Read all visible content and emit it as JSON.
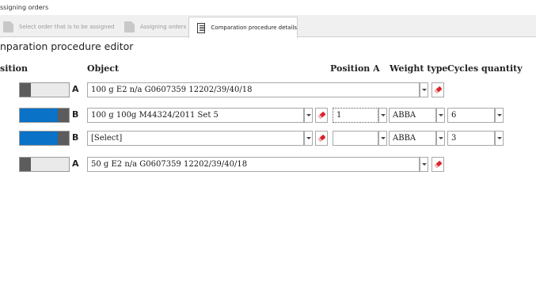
{
  "window": {
    "title": "ssigning orders"
  },
  "tabs": [
    {
      "label": "Select order that is to be assigned",
      "icon": "document-icon",
      "active": false
    },
    {
      "label": "Assigning orders",
      "icon": "document-icon",
      "active": false
    },
    {
      "label": "Comparation procedure details",
      "icon": "form-icon",
      "active": true
    }
  ],
  "editor": {
    "title": "nparation procedure editor",
    "columns": {
      "position": "sition",
      "object": "Object",
      "position_a": "Position A",
      "weight_type": "Weight type",
      "cycles_quantity": "Cycles quantity"
    },
    "rows": [
      {
        "toggle_level": 0,
        "letter": "A",
        "object": "100 g E2 n/a G0607359 12202/39/40/18"
      },
      {
        "toggle_level": 1,
        "letter": "B",
        "object": "100 g 100g M44324/2011 Set 5",
        "position_a": "1",
        "weight_type": "ABBA",
        "cycles": "6"
      },
      {
        "toggle_level": 1,
        "letter": "B",
        "object": "[Select]",
        "position_a": "",
        "weight_type": "ABBA",
        "cycles": "3"
      },
      {
        "toggle_level": 0,
        "letter": "A",
        "object": "50 g E2 n/a G0607359 12202/39/40/18"
      }
    ]
  },
  "colors": {
    "toggle_on": "#0a72c7",
    "toggle_knob": "#5c5c5c",
    "eraser": "#d9252b"
  }
}
